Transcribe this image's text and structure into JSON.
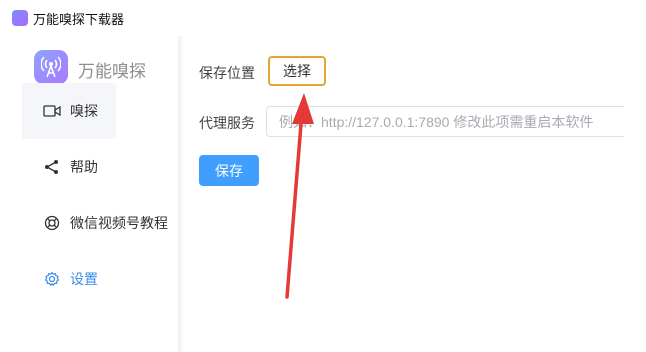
{
  "window": {
    "title": "万能嗅探下载器"
  },
  "sidebar": {
    "brand_name": "万能嗅探",
    "items": [
      {
        "label": "嗅探",
        "icon": "video-camera-icon"
      },
      {
        "label": "帮助",
        "icon": "share-icon"
      },
      {
        "label": "微信视频号教程",
        "icon": "lifebuoy-icon"
      },
      {
        "label": "设置",
        "icon": "gear-icon"
      }
    ]
  },
  "settings": {
    "save_location_label": "保存位置",
    "choose_button": "选择",
    "proxy_label": "代理服务",
    "proxy_placeholder": "例如：http://127.0.0.1:7890 修改此项需重启本软件",
    "save_button": "保存"
  },
  "colors": {
    "accent_blue": "#409eff",
    "highlight_border": "#e2a52e",
    "arrow_red": "#e53935"
  }
}
